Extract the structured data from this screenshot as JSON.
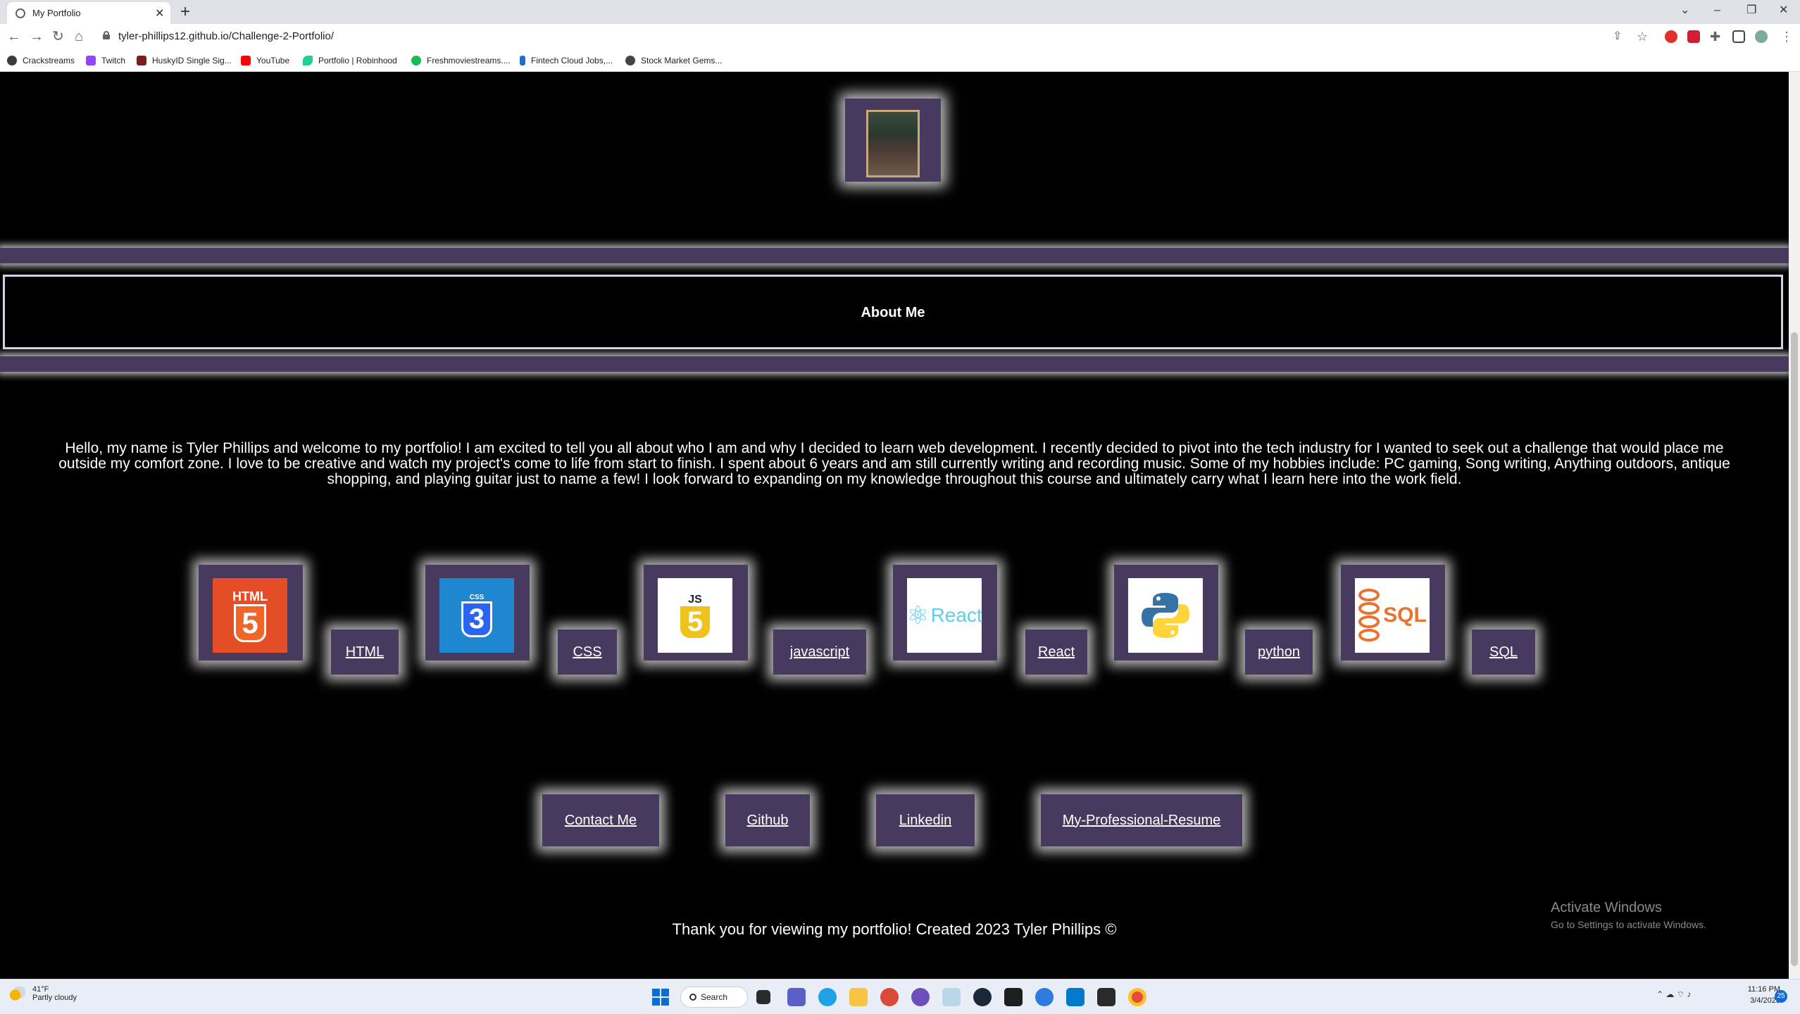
{
  "browser": {
    "tab_title": "My Portfolio",
    "new_tab": "+",
    "url": "tyler-phillips12.github.io/Challenge-2-Portfolio/",
    "window_controls": [
      "⌄",
      "–",
      "❐",
      "✕"
    ]
  },
  "bookmarks": [
    {
      "label": "Crackstreams",
      "color": "#3c3c3c"
    },
    {
      "label": "Twitch",
      "color": "#9146ff"
    },
    {
      "label": "HuskyID Single Sig...",
      "color": "#7a1f1f"
    },
    {
      "label": "YouTube",
      "color": "#ff0000"
    },
    {
      "label": "Portfolio | Robinhood",
      "color": "#21ce99"
    },
    {
      "label": "Freshmoviestreams....",
      "color": "#1db954"
    },
    {
      "label": "Fintech Cloud Jobs,...",
      "color": "#1f6fd1"
    },
    {
      "label": "Stock Market Gems...",
      "color": "#444444"
    }
  ],
  "about": {
    "title": "About Me",
    "intro": "Hello, my name is Tyler Phillips and welcome to my portfolio! I am excited to tell you all about who I am and why I decided to learn web development. I recently decided to pivot into the tech industry for I wanted to seek out a challenge that would place me outside my comfort zone. I love to be creative and watch my project's come to life from start to finish. I spent about 6 years and am still currently writing and recording music. Some of my hobbies include: PC gaming, Song writing, Anything outdoors, antique shopping, and playing guitar just to name a few! I look forward to expanding on my knowledge throughout this course and ultimately carry what I learn here into the work field."
  },
  "skills": [
    {
      "label": "HTML",
      "logo_text": "HTML",
      "logo_mark": "5",
      "icon": "html5-logo",
      "bg": "#e44d26"
    },
    {
      "label": "CSS",
      "logo_text": "CSS",
      "logo_mark": "3",
      "icon": "css3-logo",
      "bg": "#1f86d0"
    },
    {
      "label": "javascript",
      "logo_text": "JS",
      "logo_mark": "5",
      "icon": "javascript-logo",
      "bg": "#ffffff"
    },
    {
      "label": "React",
      "logo_text": "React",
      "logo_mark": "⚛",
      "icon": "react-logo",
      "bg": "#ffffff"
    },
    {
      "label": "python",
      "logo_text": "",
      "logo_mark": "",
      "icon": "python-logo",
      "bg": "#ffffff"
    },
    {
      "label": "SQL",
      "logo_text": "SQL",
      "logo_mark": "",
      "icon": "sql-logo",
      "bg": "#ffffff"
    }
  ],
  "links": [
    {
      "label": "Contact Me"
    },
    {
      "label": "Github"
    },
    {
      "label": "Linkedin"
    },
    {
      "label": "My-Professional-Resume"
    }
  ],
  "footer": "Thank you for viewing my portfolio! Created 2023 Tyler Phillips ©",
  "watermark": {
    "line1": "Activate Windows",
    "line2": "Go to Settings to activate Windows."
  },
  "taskbar": {
    "weather_temp": "41°F",
    "weather_desc": "Partly cloudy",
    "search": "Search",
    "time": "11:16 PM",
    "date": "3/4/2023",
    "notifications": "25"
  },
  "colors": {
    "accent_purple": "#483a5e",
    "glow": "#ffffff",
    "page_bg": "#000000"
  }
}
